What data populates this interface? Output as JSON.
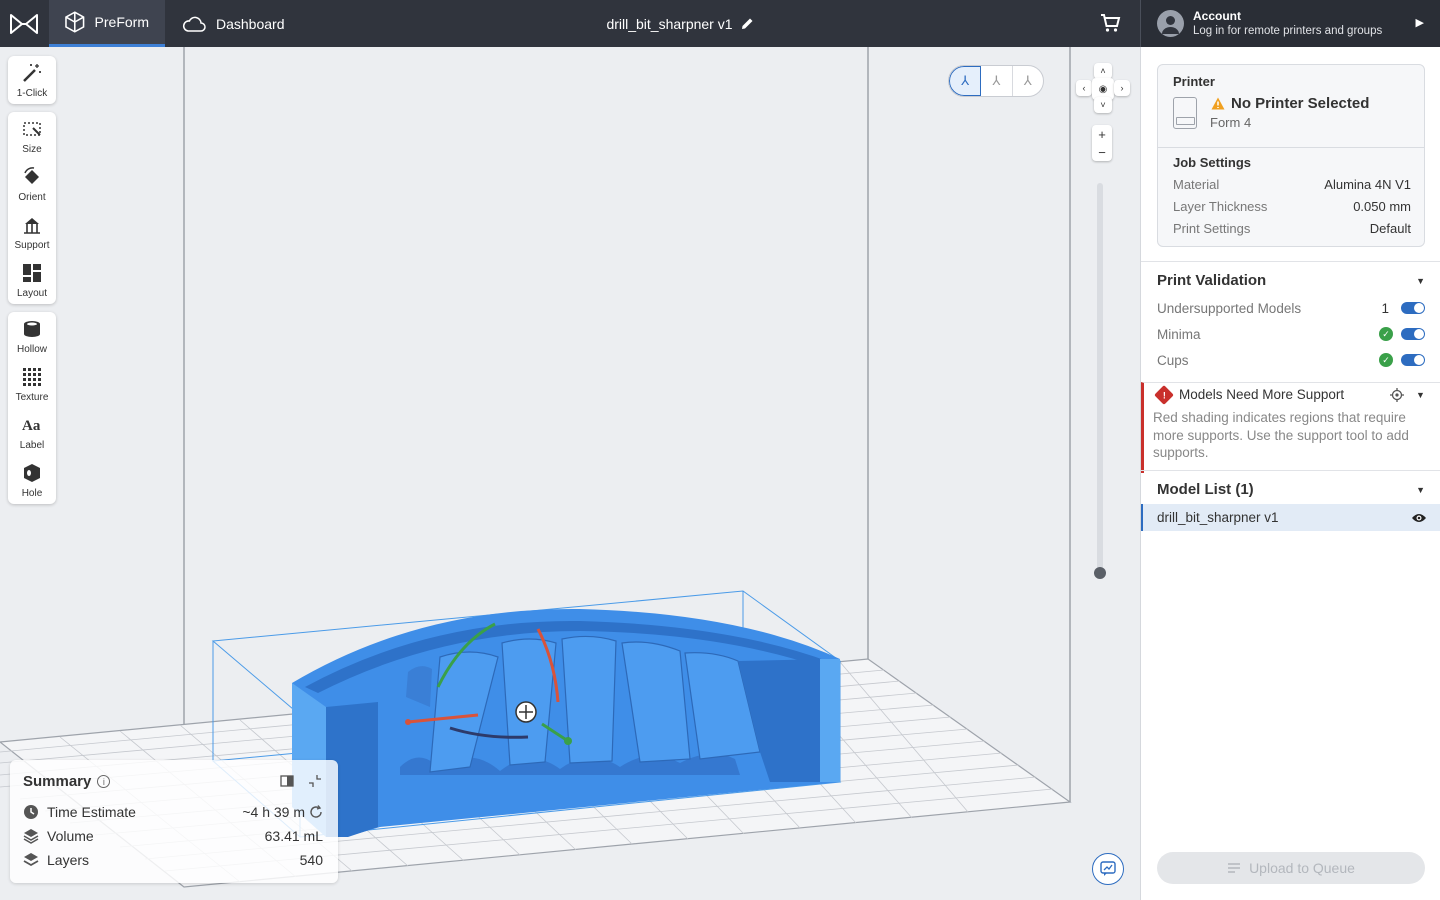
{
  "topbar": {
    "tabs": [
      {
        "label": "PreForm",
        "icon": "preform-cube-icon",
        "active": true
      },
      {
        "label": "Dashboard",
        "icon": "cloud-icon",
        "active": false
      }
    ],
    "document_title": "drill_bit_sharpner v1",
    "account": {
      "title": "Account",
      "subtitle": "Log in for remote printers and groups"
    }
  },
  "toolbar": {
    "groups": [
      [
        {
          "label": "1-Click",
          "icon": "magic-wand-icon"
        }
      ],
      [
        {
          "label": "Size",
          "icon": "size-icon"
        },
        {
          "label": "Orient",
          "icon": "orient-icon"
        },
        {
          "label": "Support",
          "icon": "support-icon"
        },
        {
          "label": "Layout",
          "icon": "layout-icon"
        }
      ],
      [
        {
          "label": "Hollow",
          "icon": "hollow-icon"
        },
        {
          "label": "Texture",
          "icon": "texture-icon"
        },
        {
          "label": "Label",
          "icon": "label-icon"
        },
        {
          "label": "Hole",
          "icon": "hole-icon"
        }
      ]
    ]
  },
  "view_buttons": [
    "⅄",
    "⅄",
    "⅄"
  ],
  "summary": {
    "title": "Summary",
    "rows": [
      {
        "label": "Time Estimate",
        "value": "~4 h 39 m",
        "icon": "clock-icon"
      },
      {
        "label": "Volume",
        "value": "63.41 mL",
        "icon": "volume-icon"
      },
      {
        "label": "Layers",
        "value": "540",
        "icon": "layers-icon"
      }
    ]
  },
  "printer": {
    "heading": "Printer",
    "status": "No Printer Selected",
    "model": "Form 4",
    "job_settings_heading": "Job Settings",
    "job_settings": [
      {
        "label": "Material",
        "value": "Alumina 4N V1"
      },
      {
        "label": "Layer Thickness",
        "value": "0.050 mm"
      },
      {
        "label": "Print Settings",
        "value": "Default"
      }
    ]
  },
  "print_validation": {
    "heading": "Print Validation",
    "rows": [
      {
        "label": "Undersupported Models",
        "count": "1",
        "status": "count",
        "enabled": true
      },
      {
        "label": "Minima",
        "count": "",
        "status": "ok",
        "enabled": true
      },
      {
        "label": "Cups",
        "count": "",
        "status": "ok",
        "enabled": true
      }
    ]
  },
  "alert": {
    "title": "Models Need More Support",
    "body": "Red shading indicates regions that require more supports. Use the support tool to add supports."
  },
  "model_list": {
    "heading": "Model List (1)",
    "items": [
      {
        "name": "drill_bit_sharpner v1",
        "visible": true
      }
    ]
  },
  "upload_button": "Upload to Queue",
  "colors": {
    "accent": "#2d6cc0",
    "topbar": "#30343d",
    "model_blue": "#3f8ee8",
    "error_red": "#c9302c",
    "ok_green": "#3aa049",
    "warning_orange": "#f0a020"
  }
}
